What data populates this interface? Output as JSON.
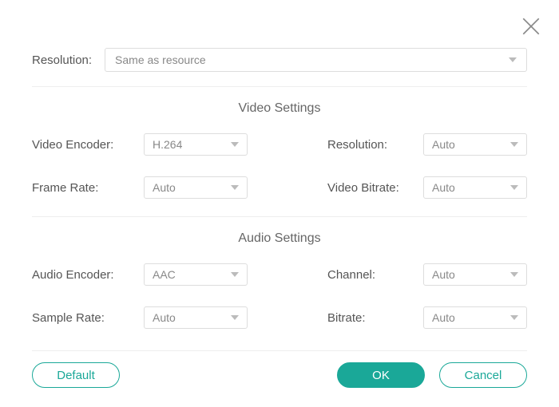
{
  "topResolution": {
    "label": "Resolution:",
    "value": "Same as resource"
  },
  "sections": {
    "video": {
      "heading": "Video Settings"
    },
    "audio": {
      "heading": "Audio Settings"
    }
  },
  "video": {
    "encoderLabel": "Video Encoder:",
    "encoderValue": "H.264",
    "resolutionLabel": "Resolution:",
    "resolutionValue": "Auto",
    "frameRateLabel": "Frame Rate:",
    "frameRateValue": "Auto",
    "bitrateLabel": "Video Bitrate:",
    "bitrateValue": "Auto"
  },
  "audio": {
    "encoderLabel": "Audio Encoder:",
    "encoderValue": "AAC",
    "channelLabel": "Channel:",
    "channelValue": "Auto",
    "sampleRateLabel": "Sample Rate:",
    "sampleRateValue": "Auto",
    "bitrateLabel": "Bitrate:",
    "bitrateValue": "Auto"
  },
  "buttons": {
    "default": "Default",
    "ok": "OK",
    "cancel": "Cancel"
  }
}
